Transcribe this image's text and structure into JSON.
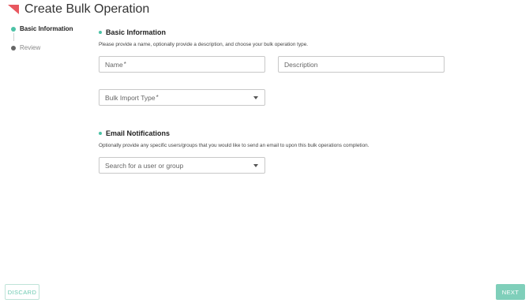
{
  "header": {
    "title": "Create Bulk Operation",
    "logo_color": "#e8575f"
  },
  "stepper": {
    "steps": [
      {
        "label": "Basic Information",
        "state": "active"
      },
      {
        "label": "Review",
        "state": "inactive"
      }
    ]
  },
  "basic_information": {
    "title": "Basic Information",
    "description": "Please provide a name, optionally provide a description, and choose your bulk operation type.",
    "name_field": {
      "label": "Name",
      "required": "*"
    },
    "description_field": {
      "label": "Description"
    },
    "bulk_import_type": {
      "label": "Bulk Import Type",
      "required": "*"
    }
  },
  "email_notifications": {
    "title": "Email Notifications",
    "description": "Optionally provide any specific users/groups that you would like to send an email to upon this bulk operations completion.",
    "search": {
      "placeholder": "Search for a user or group"
    }
  },
  "footer": {
    "discard_label": "DISCARD",
    "next_label": "NEXT"
  },
  "colors": {
    "accent": "#4cc2a6",
    "next_button": "#7fcfba",
    "logo": "#e8575f"
  }
}
